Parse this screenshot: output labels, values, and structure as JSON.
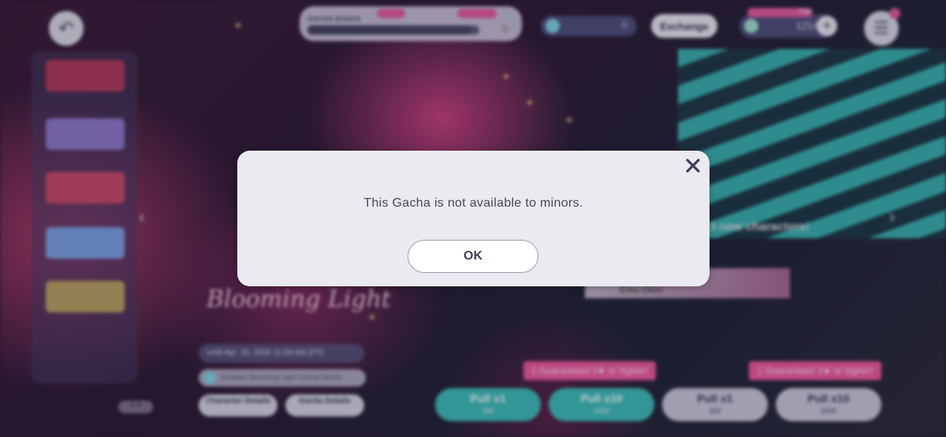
{
  "dialog": {
    "message": "This Gacha is not available to minors.",
    "ok_label": "OK",
    "close_icon": "close-icon"
  },
  "top_bar": {
    "bonus_label": "GACHA BONUS",
    "bonus_value": "0",
    "gems_value": "0",
    "exchange_label": "Exchange",
    "paid_label": "Paid",
    "paid_value": "12147",
    "plus_label": "+",
    "back_icon": "back-icon",
    "menu_icon": "menu-icon"
  },
  "banner": {
    "caption": "3 new characters!",
    "title": "Blooming Light",
    "until": "Until Apr. 20, 2026 11:59 AM (PT)",
    "includes": "Includes Blooming Light Gacha Sticker",
    "character_name": "Emu Otori",
    "character_details_label": "Character Details",
    "gacha_details_label": "Gacha Details"
  },
  "pulls": {
    "guarantee_text": "1 Guaranteed 3★ or higher!",
    "buttons": [
      {
        "label": "Pull x1",
        "cost": "100"
      },
      {
        "label": "Pull x10",
        "cost": "1000"
      },
      {
        "label": "Pull x1",
        "cost": "300"
      },
      {
        "label": "Pull x10",
        "cost": "3000"
      }
    ]
  },
  "colors": {
    "dialog_bg": "#eaeaf0",
    "accent_pink": "#e05a9a",
    "accent_teal": "#3cc9c3"
  }
}
